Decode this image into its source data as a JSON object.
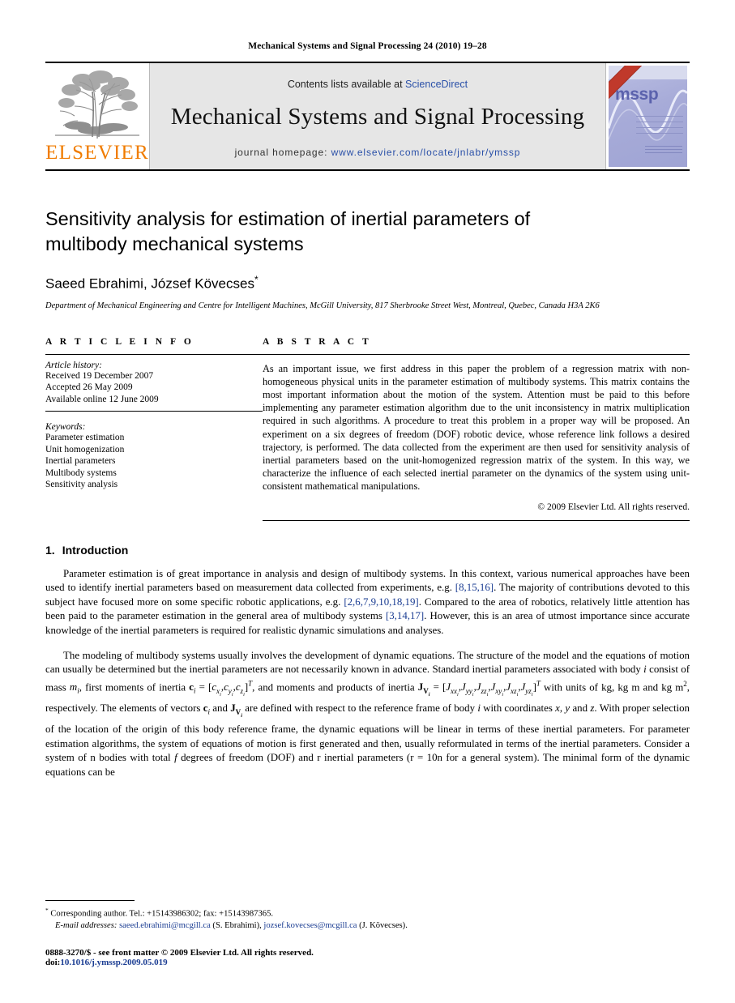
{
  "running_head": "Mechanical Systems and Signal Processing 24 (2010) 19–28",
  "masthead": {
    "publisher_logo_text": "ELSEVIER",
    "contents_prefix": "Contents lists available at ",
    "contents_link": "ScienceDirect",
    "journal_title": "Mechanical Systems and Signal Processing",
    "homepage_prefix": "journal homepage: ",
    "homepage_url": "www.elsevier.com/locate/jnlabr/ymssp",
    "cover_label": "mssp"
  },
  "article": {
    "title": "Sensitivity analysis for estimation of inertial parameters of multibody mechanical systems",
    "authors": "Saeed Ebrahimi, József Kövecses",
    "corresponding_marker": "*",
    "affiliation": "Department of Mechanical Engineering and Centre for Intelligent Machines, McGill University, 817 Sherbrooke Street West, Montreal, Quebec, Canada H3A 2K6"
  },
  "info": {
    "heading": "A R T I C L E   I N F O",
    "history_label": "Article history:",
    "history": [
      "Received 19 December 2007",
      "Accepted 26 May 2009",
      "Available online 12 June 2009"
    ],
    "keywords_label": "Keywords:",
    "keywords": [
      "Parameter estimation",
      "Unit homogenization",
      "Inertial parameters",
      "Multibody systems",
      "Sensitivity analysis"
    ]
  },
  "abstract": {
    "heading": "A B S T R A C T",
    "text": "As an important issue, we first address in this paper the problem of a regression matrix with non-homogeneous physical units in the parameter estimation of multibody systems. This matrix contains the most important information about the motion of the system. Attention must be paid to this before implementing any parameter estimation algorithm due to the unit inconsistency in matrix multiplication required in such algorithms. A procedure to treat this problem in a proper way will be proposed. An experiment on a six degrees of freedom (DOF) robotic device, whose reference link follows a desired trajectory, is performed. The data collected from the experiment are then used for sensitivity analysis of inertial parameters based on the unit-homogenized regression matrix of the system. In this way, we characterize the influence of each selected inertial parameter on the dynamics of the system using unit-consistent mathematical manipulations.",
    "copyright": "© 2009 Elsevier Ltd. All rights reserved."
  },
  "introduction": {
    "number": "1.",
    "title": "Introduction",
    "paragraph1_part1": "Parameter estimation is of great importance in analysis and design of multibody systems. In this context, various numerical approaches have been used to identify inertial parameters based on measurement data collected from experiments, e.g. ",
    "paragraph1_cite1": "[8,15,16]",
    "paragraph1_part2": ". The majority of contributions devoted to this subject have focused more on some specific robotic applications, e.g. ",
    "paragraph1_cite2": "[2,6,7,9,10,18,19]",
    "paragraph1_part3": ". Compared to the area of robotics, relatively little attention has been paid to the parameter estimation in the general area of multibody systems ",
    "paragraph1_cite3": "[3,14,17]",
    "paragraph1_part4": ". However, this is an area of utmost importance since accurate knowledge of the inertial parameters is required for realistic dynamic simulations and analyses.",
    "paragraph2_part1": "The modeling of multibody systems usually involves the development of dynamic equations. The structure of the model and the equations of motion can usually be determined but the inertial parameters are not necessarily known in advance. Standard inertial parameters associated with body ",
    "paragraph2_part2": " consist of mass ",
    "paragraph2_part3": ", first moments of inertia ",
    "paragraph2_part4": ", and moments and products of inertia ",
    "paragraph2_part5": " with units of kg, kg m and kg m",
    "paragraph2_part6": ", respectively. The elements of vectors ",
    "paragraph2_part7": " and ",
    "paragraph2_part8": " are defined with respect to the reference frame of body ",
    "paragraph2_part9": " with coordinates ",
    "paragraph2_part10": ". With proper selection of the location of the origin of this body reference frame, the dynamic equations will be linear in terms of these inertial parameters. For parameter estimation algorithms, the system of equations of motion is first generated and then, usually reformulated in terms of the inertial parameters. Consider a system of n bodies with total ",
    "paragraph2_part11": " degrees of freedom (DOF) and r inertial parameters (r = 10n for a general system). The minimal form of the dynamic equations can be"
  },
  "footnote": {
    "marker": "*",
    "corresponding": "Corresponding author. Tel.: +15143986302; fax: +15143987365.",
    "email_label": "E-mail addresses:",
    "email1": "saeed.ebrahimi@mcgill.ca",
    "email1_name": " (S. Ebrahimi), ",
    "email2": "jozsef.kovecses@mcgill.ca",
    "email2_name": " (J. Kövecses)."
  },
  "footer": {
    "issn_line": "0888-3270/$ - see front matter © 2009 Elsevier Ltd. All rights reserved.",
    "doi_label": "doi:",
    "doi_value": "10.1016/j.ymssp.2009.05.019"
  },
  "colors": {
    "link": "#1a3c92",
    "elsevier_orange": "#f07c00",
    "masthead_bg": "#e6e6e6",
    "cover_purple": "#9fa4d4"
  }
}
